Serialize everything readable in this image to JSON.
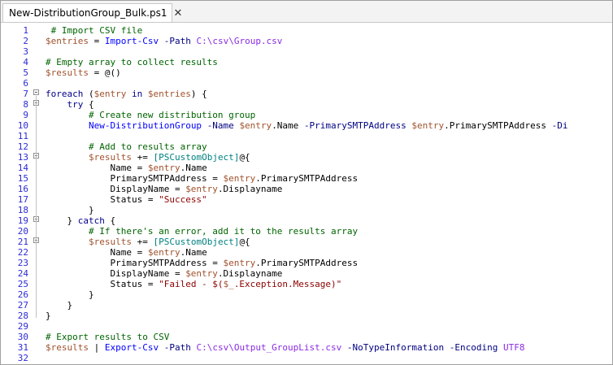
{
  "tab": {
    "title": "New-DistributionGroup_Bulk.ps1"
  },
  "lines": [
    {
      "n": "1",
      "tokens": [
        [
          "cmt",
          " # Import CSV file"
        ]
      ]
    },
    {
      "n": "2",
      "tokens": [
        [
          "var",
          "$entries"
        ],
        [
          "plain",
          " = "
        ],
        [
          "cmd",
          "Import-Csv"
        ],
        [
          "plain",
          " "
        ],
        [
          "param",
          "-Path"
        ],
        [
          "plain",
          " "
        ],
        [
          "path",
          "C:\\csv\\Group.csv"
        ]
      ]
    },
    {
      "n": "3",
      "tokens": []
    },
    {
      "n": "4",
      "tokens": [
        [
          "cmt",
          "# Empty array to collect results"
        ]
      ]
    },
    {
      "n": "5",
      "tokens": [
        [
          "var",
          "$results"
        ],
        [
          "plain",
          " = @()"
        ]
      ]
    },
    {
      "n": "6",
      "tokens": []
    },
    {
      "n": "7",
      "tokens": [
        [
          "kw",
          "foreach"
        ],
        [
          "plain",
          " ("
        ],
        [
          "var",
          "$entry"
        ],
        [
          "plain",
          " "
        ],
        [
          "kw",
          "in"
        ],
        [
          "plain",
          " "
        ],
        [
          "var",
          "$entries"
        ],
        [
          "plain",
          ") {"
        ]
      ]
    },
    {
      "n": "8",
      "tokens": [
        [
          "plain",
          "    "
        ],
        [
          "kw",
          "try"
        ],
        [
          "plain",
          " {"
        ]
      ]
    },
    {
      "n": "9",
      "tokens": [
        [
          "plain",
          "        "
        ],
        [
          "cmt",
          "# Create new distribution group"
        ]
      ]
    },
    {
      "n": "10",
      "tokens": [
        [
          "plain",
          "        "
        ],
        [
          "cmd",
          "New-DistributionGroup"
        ],
        [
          "plain",
          " "
        ],
        [
          "param",
          "-Name"
        ],
        [
          "plain",
          " "
        ],
        [
          "var",
          "$entry"
        ],
        [
          "plain",
          ".Name "
        ],
        [
          "param",
          "-PrimarySMTPAddress"
        ],
        [
          "plain",
          " "
        ],
        [
          "var",
          "$entry"
        ],
        [
          "plain",
          ".PrimarySMTPAddress "
        ],
        [
          "param",
          "-Di"
        ]
      ]
    },
    {
      "n": "11",
      "tokens": []
    },
    {
      "n": "12",
      "tokens": [
        [
          "plain",
          "        "
        ],
        [
          "cmt",
          "# Add to results array"
        ]
      ]
    },
    {
      "n": "13",
      "tokens": [
        [
          "plain",
          "        "
        ],
        [
          "var",
          "$results"
        ],
        [
          "plain",
          " += "
        ],
        [
          "type",
          "[PSCustomObject]"
        ],
        [
          "plain",
          "@{"
        ]
      ]
    },
    {
      "n": "14",
      "tokens": [
        [
          "plain",
          "            Name = "
        ],
        [
          "var",
          "$entry"
        ],
        [
          "plain",
          ".Name"
        ]
      ]
    },
    {
      "n": "15",
      "tokens": [
        [
          "plain",
          "            PrimarySMTPAddress = "
        ],
        [
          "var",
          "$entry"
        ],
        [
          "plain",
          ".PrimarySMTPAddress"
        ]
      ]
    },
    {
      "n": "16",
      "tokens": [
        [
          "plain",
          "            DisplayName = "
        ],
        [
          "var",
          "$entry"
        ],
        [
          "plain",
          ".Displayname"
        ]
      ]
    },
    {
      "n": "17",
      "tokens": [
        [
          "plain",
          "            Status = "
        ],
        [
          "str",
          "\"Success\""
        ]
      ]
    },
    {
      "n": "18",
      "tokens": [
        [
          "plain",
          "        }"
        ]
      ]
    },
    {
      "n": "19",
      "tokens": [
        [
          "plain",
          "    } "
        ],
        [
          "kw",
          "catch"
        ],
        [
          "plain",
          " {"
        ]
      ]
    },
    {
      "n": "20",
      "tokens": [
        [
          "plain",
          "        "
        ],
        [
          "cmt",
          "# If there's an error, add it to the results array"
        ]
      ]
    },
    {
      "n": "21",
      "tokens": [
        [
          "plain",
          "        "
        ],
        [
          "var",
          "$results"
        ],
        [
          "plain",
          " += "
        ],
        [
          "type",
          "[PSCustomObject]"
        ],
        [
          "plain",
          "@{"
        ]
      ]
    },
    {
      "n": "22",
      "tokens": [
        [
          "plain",
          "            Name = "
        ],
        [
          "var",
          "$entry"
        ],
        [
          "plain",
          ".Name"
        ]
      ]
    },
    {
      "n": "23",
      "tokens": [
        [
          "plain",
          "            PrimarySMTPAddress = "
        ],
        [
          "var",
          "$entry"
        ],
        [
          "plain",
          ".PrimarySMTPAddress"
        ]
      ]
    },
    {
      "n": "24",
      "tokens": [
        [
          "plain",
          "            DisplayName = "
        ],
        [
          "var",
          "$entry"
        ],
        [
          "plain",
          ".Displayname"
        ]
      ]
    },
    {
      "n": "25",
      "tokens": [
        [
          "plain",
          "            Status = "
        ],
        [
          "str",
          "\"Failed - $("
        ],
        [
          "var",
          "$_"
        ],
        [
          "str",
          ".Exception.Message)\""
        ]
      ]
    },
    {
      "n": "26",
      "tokens": [
        [
          "plain",
          "        }"
        ]
      ]
    },
    {
      "n": "27",
      "tokens": [
        [
          "plain",
          "    }"
        ]
      ]
    },
    {
      "n": "28",
      "tokens": [
        [
          "plain",
          "}"
        ]
      ]
    },
    {
      "n": "29",
      "tokens": []
    },
    {
      "n": "30",
      "tokens": [
        [
          "cmt",
          "# Export results to CSV"
        ]
      ]
    },
    {
      "n": "31",
      "tokens": [
        [
          "var",
          "$results"
        ],
        [
          "plain",
          " | "
        ],
        [
          "cmd",
          "Export-Csv"
        ],
        [
          "plain",
          " "
        ],
        [
          "param",
          "-Path"
        ],
        [
          "plain",
          " "
        ],
        [
          "path",
          "C:\\csv\\Output_GroupList.csv"
        ],
        [
          "plain",
          " "
        ],
        [
          "param",
          "-NoTypeInformation"
        ],
        [
          "plain",
          " "
        ],
        [
          "param",
          "-Encoding"
        ],
        [
          "plain",
          " "
        ],
        [
          "path",
          "UTF8"
        ]
      ]
    },
    {
      "n": "32",
      "tokens": []
    }
  ],
  "folds": [
    "7",
    "8",
    "13",
    "19",
    "21"
  ],
  "colors": {
    "comment": "#006400",
    "variable": "#a0522d",
    "command": "#0000ff",
    "parameter": "#000080",
    "path": "#8a2be2",
    "string": "#8b0000",
    "type": "#008080",
    "keyword": "#00008b",
    "line_number": "#2b2bd6"
  },
  "icons": {
    "tab_close": "close-icon"
  }
}
